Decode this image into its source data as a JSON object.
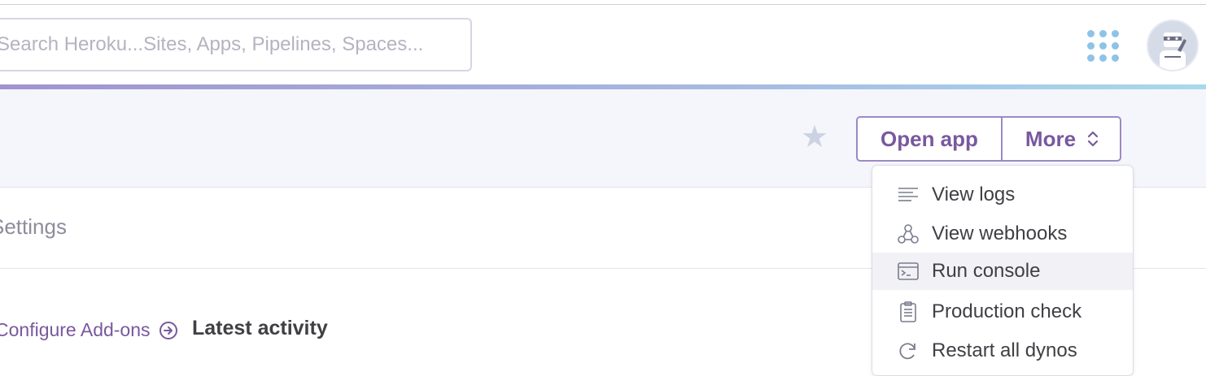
{
  "search": {
    "placeholder": "Search Heroku...Sites, Apps, Pipelines, Spaces..."
  },
  "header": {
    "apps_grid_icon": "apps-grid-icon",
    "avatar_icon": "avatar-icon"
  },
  "app_header": {
    "favorite_icon": "star-icon",
    "open_app_label": "Open app",
    "more_label": "More"
  },
  "tabs": {
    "settings_label": "Settings"
  },
  "overview": {
    "configure_addons_label": "Configure Add-ons",
    "latest_activity_title": "Latest activity"
  },
  "more_menu": {
    "items": [
      {
        "label": "View logs",
        "icon": "logs-icon"
      },
      {
        "label": "View webhooks",
        "icon": "webhooks-icon"
      },
      {
        "label": "Run console",
        "icon": "console-icon",
        "highlighted": true
      },
      {
        "label": "Production check",
        "icon": "clipboard-icon"
      },
      {
        "label": "Restart all dynos",
        "icon": "restart-icon"
      }
    ]
  },
  "colors": {
    "accent": "#79589f",
    "text": "#3f3f44",
    "muted": "#8d8d9c"
  }
}
